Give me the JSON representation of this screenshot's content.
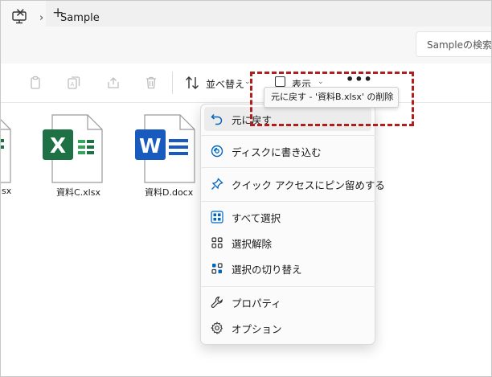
{
  "tab": {
    "close_glyph": "✕",
    "new_tab_glyph": "+"
  },
  "address": {
    "location_icon": "computer-icon",
    "chevron": "›",
    "path": "Sample",
    "search_placeholder": "Sampleの検索"
  },
  "toolbar": {
    "icons": [
      "cut-icon",
      "copy-icon",
      "rename-icon",
      "share-icon",
      "delete-icon"
    ],
    "sort_label": "並べ替え",
    "view_label": "表示",
    "more_label": "•••",
    "dropdown_glyph": "⌄"
  },
  "tooltip": {
    "text": "元に戻す - '資料B.xlsx' の削除"
  },
  "files": [
    {
      "name": "lsx",
      "type": "excel"
    },
    {
      "name": "資料C.xlsx",
      "type": "excel"
    },
    {
      "name": "資料D.docx",
      "type": "word"
    }
  ],
  "menu": {
    "items": [
      {
        "label": "元に戻す",
        "icon": "undo-icon"
      },
      {
        "label": "ディスクに書き込む",
        "icon": "disc-burn-icon"
      },
      {
        "label": "クイック アクセスにピン留めする",
        "icon": "pin-icon"
      },
      {
        "label": "すべて選択",
        "icon": "select-all-icon"
      },
      {
        "label": "選択解除",
        "icon": "select-none-icon"
      },
      {
        "label": "選択の切り替え",
        "icon": "invert-selection-icon"
      },
      {
        "label": "プロパティ",
        "icon": "wrench-icon"
      },
      {
        "label": "オプション",
        "icon": "gear-icon"
      }
    ]
  },
  "colors": {
    "highlight_border": "#b01e1e",
    "excel_green": "#1e7145",
    "word_blue": "#185abd",
    "accent": "#0067c0"
  }
}
